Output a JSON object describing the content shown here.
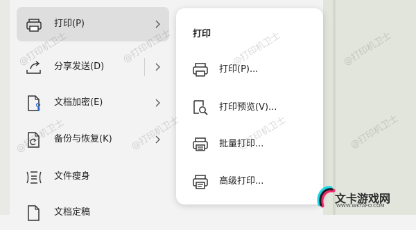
{
  "menu": {
    "items": [
      {
        "label": "打印(P)",
        "icon": "printer-icon",
        "active": true
      },
      {
        "label": "分享发送(D)",
        "icon": "share-icon",
        "active": false
      },
      {
        "label": "文档加密(E)",
        "icon": "encrypt-document-icon",
        "active": false
      },
      {
        "label": "备份与恢复(K)",
        "icon": "backup-icon",
        "active": false
      },
      {
        "label": "文件瘦身",
        "icon": "compress-file-icon",
        "active": false
      },
      {
        "label": "文档定稿",
        "icon": "finalize-document-icon",
        "active": false
      }
    ]
  },
  "submenu": {
    "title": "打印",
    "items": [
      {
        "label": "打印(P)...",
        "icon": "printer-icon"
      },
      {
        "label": "打印预览(V)...",
        "icon": "print-preview-icon"
      },
      {
        "label": "批量打印...",
        "icon": "batch-print-icon"
      },
      {
        "label": "高级打印...",
        "icon": "advanced-print-icon"
      }
    ]
  },
  "watermark": "@打印机卫士",
  "logo": {
    "text": "文卡游戏网",
    "sub": "WWW.WKTAFO.COM"
  },
  "colors": {
    "active_bg": "#dedede",
    "panel_bg": "#ffffff",
    "menu_bg": "#f3f3f3",
    "right_bg": "#e2e5dc"
  }
}
